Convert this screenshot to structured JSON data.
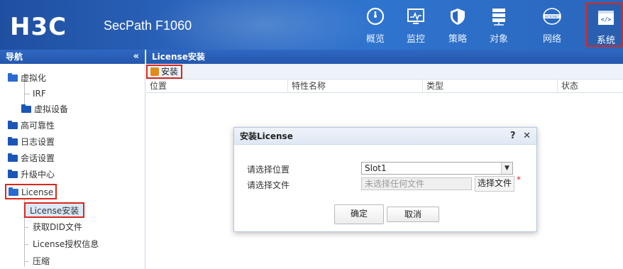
{
  "header": {
    "logo": "H3C",
    "product": "SecPath F1060",
    "nav": [
      {
        "label": "概览",
        "icon": "gauge-icon"
      },
      {
        "label": "监控",
        "icon": "monitor-icon"
      },
      {
        "label": "策略",
        "icon": "shield-icon"
      },
      {
        "label": "对象",
        "icon": "server-icon"
      },
      {
        "label": "网络",
        "icon": "internet-icon",
        "icon_text": "INTERNET"
      },
      {
        "label": "系统",
        "icon": "code-icon",
        "icon_text": "</>"
      }
    ]
  },
  "sidebar": {
    "title": "导航",
    "collapse_label": "«",
    "items": [
      {
        "label": "虚拟化"
      },
      {
        "label": "IRF"
      },
      {
        "label": "虚拟设备"
      },
      {
        "label": "高可靠性"
      },
      {
        "label": "日志设置"
      },
      {
        "label": "会话设置"
      },
      {
        "label": "升级中心"
      },
      {
        "label": "License"
      },
      {
        "label": "License安装"
      },
      {
        "label": "获取DID文件"
      },
      {
        "label": "License授权信息"
      },
      {
        "label": "压缩"
      }
    ]
  },
  "main": {
    "title": "License安装",
    "toolbar": {
      "install_label": "安装"
    },
    "columns": [
      "位置",
      "特性名称",
      "类型",
      "状态"
    ]
  },
  "dialog": {
    "title": "安装License",
    "help": "?",
    "close": "✕",
    "location_label": "请选择位置",
    "location_value": "Slot1",
    "file_label": "请选择文件",
    "file_placeholder": "未选择任何文件",
    "choose_file_label": "选择文件",
    "required_mark": "*",
    "ok_label": "确定",
    "cancel_label": "取消"
  },
  "colors": {
    "accent": "#2c67c0",
    "highlight": "#d9281d"
  }
}
